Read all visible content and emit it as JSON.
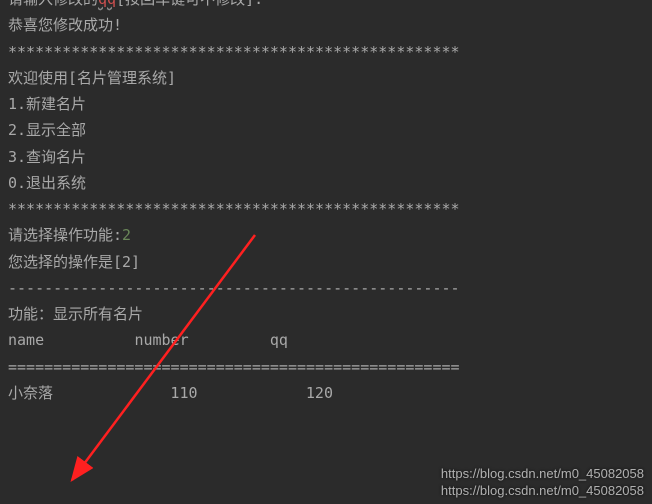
{
  "terminal": {
    "line_top_partial": "请输入修改的qq[按回车键可不修改]:",
    "line_success": "恭喜您修改成功!",
    "separator_stars": "**************************************************",
    "line_welcome": "欢迎使用[名片管理系统]",
    "menu": {
      "item1": "1.新建名片",
      "item2": "2.显示全部",
      "item3": "3.查询名片",
      "item0": "0.退出系统"
    },
    "line_select_label": "请选择操作功能:",
    "input_value": "2",
    "line_selected": "您选择的操作是[2]",
    "separator_dashes": "--------------------------------------------------",
    "line_function": "功能：显示所有名片",
    "header": {
      "name": "name",
      "number": "number",
      "qq": "qq"
    },
    "separator_equals": "==================================================",
    "row1": {
      "name": "小奈落",
      "number": "110",
      "qq": "120"
    }
  },
  "watermark": {
    "line1": "https://blog.csdn.net/m0_45082058",
    "line2": "https://blog.csdn.net/m0_45082058"
  }
}
